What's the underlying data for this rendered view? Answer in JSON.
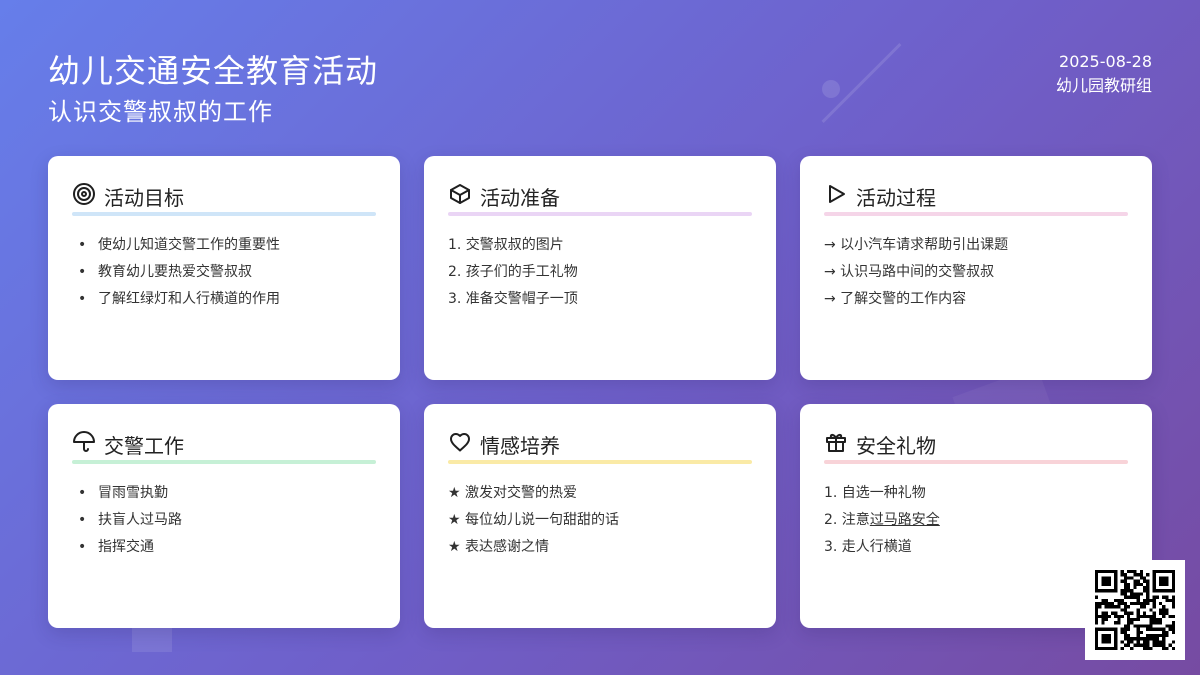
{
  "header": {
    "title": "幼儿交通安全教育活动",
    "subtitle": "认识交警叔叔的工作",
    "date": "2025-08-28",
    "organizer": "幼儿园教研组"
  },
  "cards": [
    {
      "title": "活动目标",
      "icon": "target-icon",
      "accent": "#cfe5f8",
      "items": [
        "使幼儿知道交警工作的重要性",
        "教育幼儿要热爱交警叔叔",
        "了解红绿灯和人行横道的作用"
      ]
    },
    {
      "title": "活动准备",
      "icon": "box-icon",
      "accent": "#ead5f5",
      "items": [
        "1. 交警叔叔的图片",
        "2. 孩子们的手工礼物",
        "3. 准备交警帽子一顶"
      ]
    },
    {
      "title": "活动过程",
      "icon": "play-icon",
      "accent": "#f5d5e8",
      "items": [
        "→ 以小汽车请求帮助引出课题",
        "→ 认识马路中间的交警叔叔",
        "→ 了解交警的工作内容"
      ]
    },
    {
      "title": "交警工作",
      "icon": "umbrella-icon",
      "accent": "#c6f0d6",
      "items": [
        "冒雨雪执勤",
        "扶盲人过马路",
        "指挥交通"
      ]
    },
    {
      "title": "情感培养",
      "icon": "heart-icon",
      "accent": "#faeaa6",
      "items": [
        "★ 激发对交警的热爱",
        "★ 每位幼儿说一句甜甜的话",
        "★ 表达感谢之情"
      ]
    },
    {
      "title": "安全礼物",
      "icon": "gift-icon",
      "accent": "#f8d3d8",
      "items": [
        "1. 自选一种礼物",
        "2. 注意过马路安全",
        "3. 走人行横道"
      ]
    }
  ],
  "qr_code": {
    "icon": "qr-code-icon"
  }
}
